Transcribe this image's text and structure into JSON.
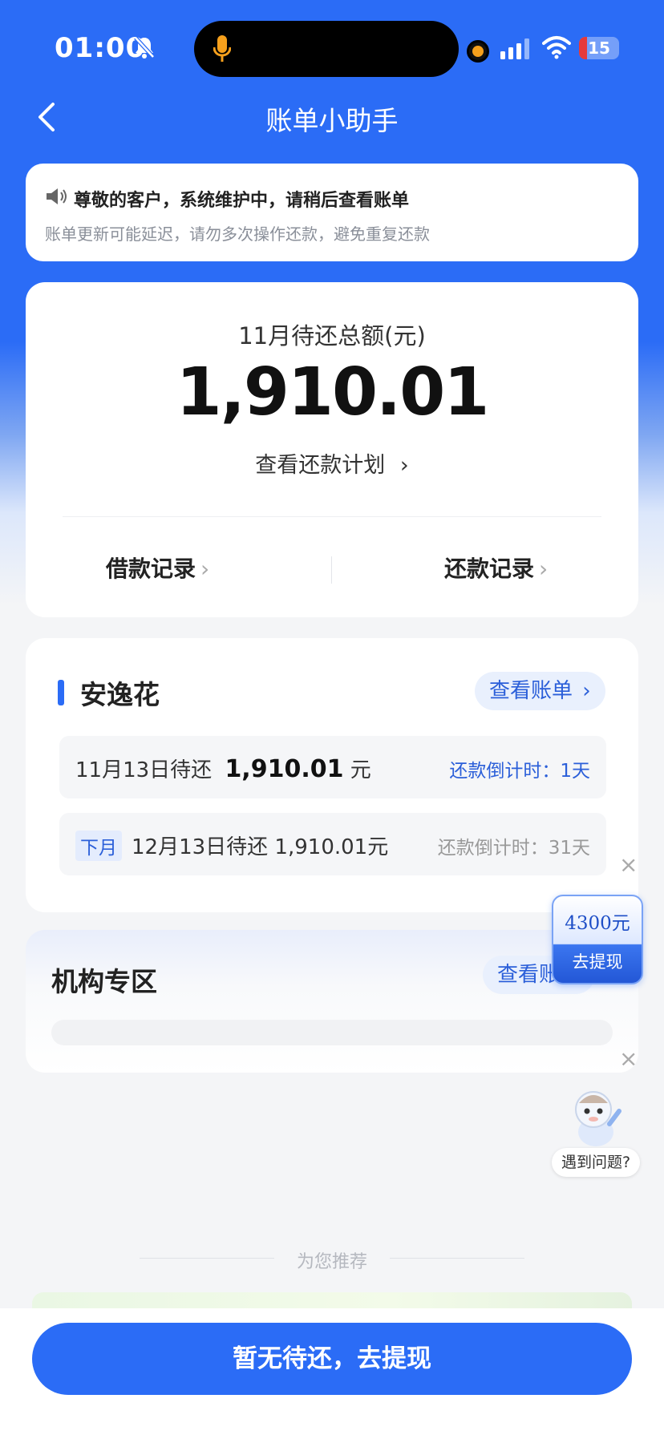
{
  "status_bar": {
    "time": "01:00",
    "battery": "15"
  },
  "nav": {
    "title": "账单小助手"
  },
  "notice": {
    "title": "尊敬的客户，系统维护中，请稍后查看账单",
    "subtitle": "账单更新可能延迟，请勿多次操作还款，避免重复还款"
  },
  "summary": {
    "label": "11月待还总额(元)",
    "amount": "1,910.01",
    "plan_link": "查看还款计划",
    "borrow_records": "借款记录",
    "repay_records": "还款记录"
  },
  "product": {
    "name": "安逸花",
    "view_bill": "查看账单",
    "rows": [
      {
        "due_text": "11月13日待还",
        "amount": "1,910.01",
        "unit": "元",
        "countdown": "还款倒计时：1天"
      },
      {
        "tag": "下月",
        "due_text": "12月13日待还 1,910.01元",
        "countdown": "还款倒计时：31天"
      }
    ]
  },
  "institution": {
    "title": "机构专区",
    "view_bill": "查看账单"
  },
  "float_offer": {
    "amount": "4300元",
    "action": "去提现"
  },
  "helper": {
    "ask": "遇到问题?"
  },
  "recommend": {
    "label": "为您推荐"
  },
  "cta": {
    "label": "暂无待还，去提现"
  },
  "icons": [
    "microphone-icon",
    "mute-bell-icon",
    "signal-icon",
    "wifi-icon",
    "battery-icon",
    "back-icon",
    "speaker-icon",
    "chevron-right-icon",
    "close-icon",
    "robot-mascot-icon"
  ],
  "colors": {
    "primary": "#2b6cf6",
    "link": "#2b5fd9",
    "background": "#f4f5f7"
  }
}
